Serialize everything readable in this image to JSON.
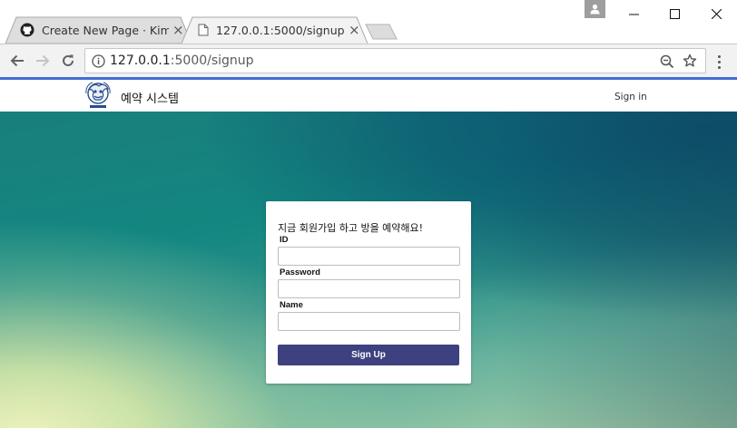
{
  "browser": {
    "tabs": [
      {
        "title": "Create New Page · KimJ",
        "icon": "github-icon",
        "close": "×"
      },
      {
        "title": "127.0.0.1:5000/signup",
        "icon": "page-icon",
        "close": "×"
      }
    ],
    "address": {
      "host": "127.0.0.1",
      "path": ":5000/signup"
    }
  },
  "navbar": {
    "brand": "예약 시스템",
    "logo": "logo-emblem",
    "signin": "Sign in"
  },
  "signup_form": {
    "title": "지금 회원가입 하고 방을 예약해요!",
    "id_label": "ID",
    "id_value": "",
    "password_label": "Password",
    "password_value": "",
    "name_label": "Name",
    "name_value": "",
    "submit_label": "Sign Up"
  },
  "colors": {
    "accent_line": "#3f6fd1",
    "submit_button": "#3e4180",
    "hero_teal": "#138781",
    "hero_light": "#eef3bd"
  }
}
